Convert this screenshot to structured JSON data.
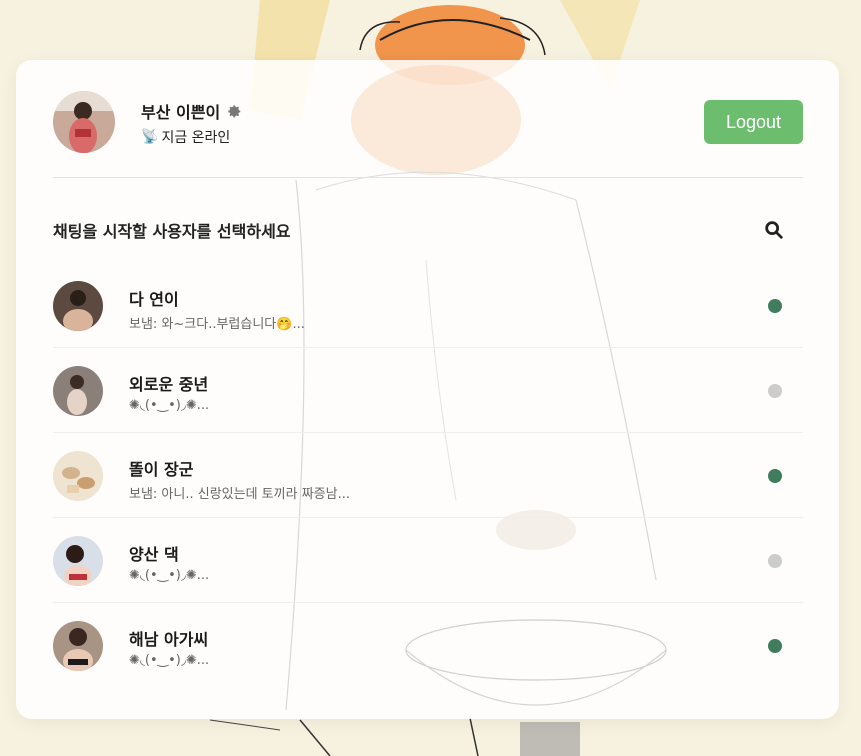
{
  "colors": {
    "online": "#3f7d5d",
    "offline": "#cccccc",
    "logout_bg": "#6dbd6f",
    "background": "#f7f1df"
  },
  "profile": {
    "name": "부산 이쁜이",
    "status_icon": "satellite-antenna-icon",
    "status_icon_glyph": "📡",
    "status_text": "지금 온라인",
    "settings_icon": "gear-icon"
  },
  "header": {
    "logout_label": "Logout"
  },
  "list_header": {
    "prompt": "채팅을 시작할 사용자를 선택하세요",
    "search_icon": "search-icon"
  },
  "users": [
    {
      "name": "다 연이",
      "message": "보냄: 와~크다..부럽습니다🤭...",
      "status": "online"
    },
    {
      "name": "외로운 중년",
      "message": "✺◟(•‿•)◞✺...",
      "status": "offline"
    },
    {
      "name": "똘이 장군",
      "message": "보냄: 아니.. 신랑있는데 토끼라 짜증남...",
      "status": "online"
    },
    {
      "name": "양산 댁",
      "message": "✺◟(•‿•)◞✺...",
      "status": "offline"
    },
    {
      "name": "해남 아가씨",
      "message": "✺◟(•‿•)◞✺...",
      "status": "online"
    }
  ]
}
